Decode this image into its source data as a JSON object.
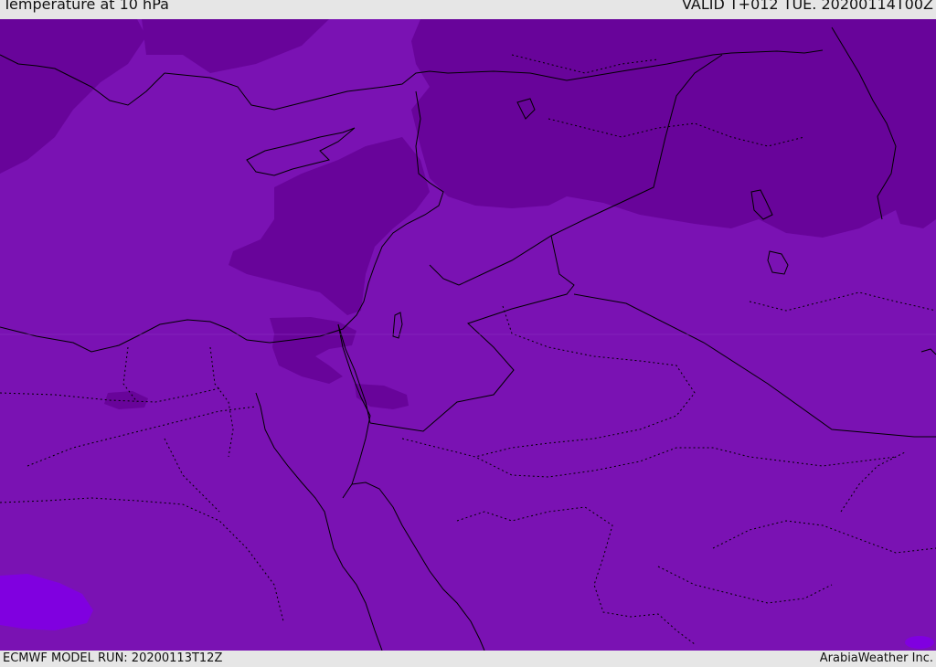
{
  "header": {
    "title": "Temperature at 10 hPa",
    "valid_time": "VALID T+012 TUE. 20200114T00Z"
  },
  "footer": {
    "model_run": "ECMWF MODEL RUN: 20200113T12Z",
    "credit": "ArabiaWeather Inc."
  },
  "colors": {
    "background_field": "#7a12b3",
    "colder_field": "#68049a",
    "warmer_field": "#8000e0",
    "border_line": "#000000",
    "chrome": "#e6e6e6"
  }
}
